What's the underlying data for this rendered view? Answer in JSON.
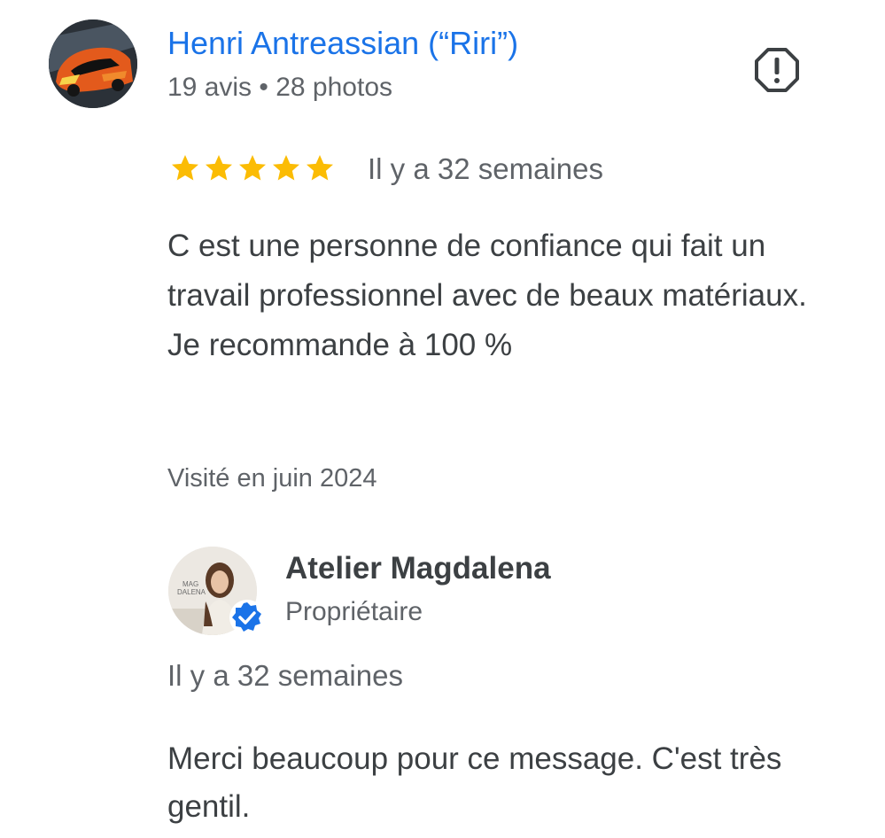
{
  "review": {
    "reviewer": {
      "name": "Henri Antreassian (“Riri”)",
      "meta": "19 avis • 28 photos",
      "avatar_icon": "car-photo-avatar"
    },
    "report_icon": "report-octagon-icon",
    "rating": {
      "value": 5,
      "max": 5,
      "star_color": "#fbbc04"
    },
    "date": "Il y a 32 semaines",
    "text": [
      "C est une personne de confiance qui fait un travail professionnel avec de beaux matériaux.",
      "Je recommande à 100 %"
    ],
    "visited": "Visité en juin 2024"
  },
  "owner_response": {
    "name": "Atelier Magdalena",
    "role": "Propriétaire",
    "avatar_icon": "owner-photo-avatar",
    "verified_icon": "verified-badge-icon",
    "verified_color": "#1a73e8",
    "date": "Il y a 32 semaines",
    "text": "Merci beaucoup pour ce message. C'est très gentil.",
    "logo_text": [
      "MAG",
      "DALENA"
    ]
  },
  "colors": {
    "link_blue": "#1a73e8",
    "text_primary": "#3c4043",
    "text_secondary": "#5f6368"
  }
}
